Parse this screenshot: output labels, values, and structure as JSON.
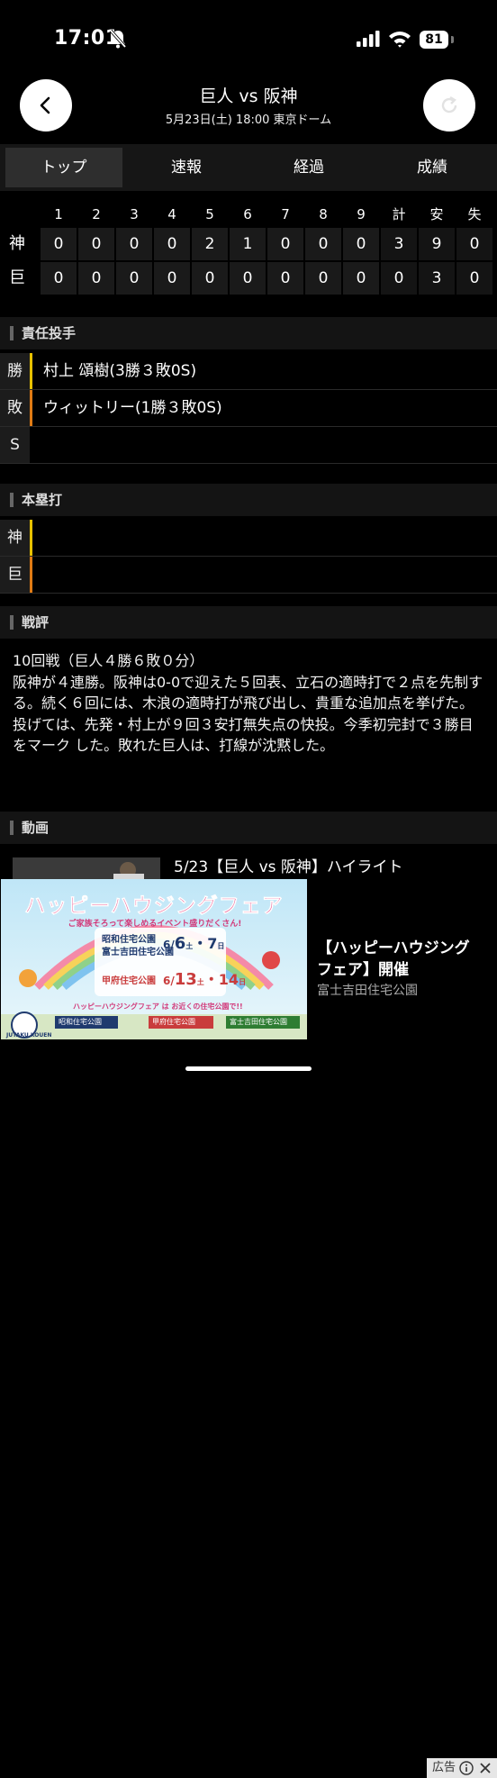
{
  "status": {
    "time": "17:01",
    "battery": "81"
  },
  "header": {
    "title": "巨人 vs 阪神",
    "subtitle": "5月23日(土) 18:00 東京ドーム",
    "back_icon": "chevron-left-icon",
    "refresh_icon": "refresh-icon"
  },
  "tabs": [
    "トップ",
    "速報",
    "経過",
    "成績"
  ],
  "scoreboard": {
    "headers": [
      "1",
      "2",
      "3",
      "4",
      "5",
      "6",
      "7",
      "8",
      "9",
      "計",
      "安",
      "失"
    ],
    "rows": [
      {
        "team": "神",
        "cells": [
          "0",
          "0",
          "0",
          "0",
          "2",
          "1",
          "0",
          "0",
          "0",
          "3",
          "9",
          "0"
        ]
      },
      {
        "team": "巨",
        "cells": [
          "0",
          "0",
          "0",
          "0",
          "0",
          "0",
          "0",
          "0",
          "0",
          "0",
          "3",
          "0"
        ]
      }
    ]
  },
  "pitchers": {
    "heading": "責任投手",
    "rows": [
      {
        "label": "勝",
        "value": "村上 頌樹(3勝３敗0S)",
        "color": "#e8c100"
      },
      {
        "label": "敗",
        "value": "ウィットリー(1勝３敗0S)",
        "color": "#e07b14"
      },
      {
        "label": "S",
        "value": "",
        "color": "#1c1c1c"
      }
    ]
  },
  "homeruns": {
    "heading": "本塁打",
    "rows": [
      {
        "label": "神",
        "value": "",
        "color": "#e8c100"
      },
      {
        "label": "巨",
        "value": "",
        "color": "#e07b14"
      }
    ]
  },
  "review": {
    "heading": "戦評",
    "line1": "10回戦（巨人４勝６敗０分）",
    "body": "阪神が４連勝。阪神は0-0で迎えた５回表、立石の適時打で２点を先制する。続く６回には、木浪の適時打が飛び出し、貴重な追加点を挙げた。投げては、先発・村上が９回３安打無失点の快投。今季初完封で３勝目をマーク した。敗れた巨人は、打線が沈黙した。"
  },
  "video": {
    "heading": "動画",
    "title": "5/23【巨人 vs 阪神】ハイライト"
  },
  "ad": {
    "badge": "広告",
    "title": "【ハッピーハウジング フェア】開催",
    "sponsor": "富士吉田住宅公園",
    "banner_title": "ハッピーハウジングフェア",
    "banner_sub": "ご家族そろって楽しめるイベント盛りだくさん!",
    "venue1": "昭和住宅公園",
    "venue2": "富士吉田住宅公園",
    "venue3": "甲府住宅公園",
    "date1a": "6/",
    "date1b": "6",
    "date1c": "土",
    "date1d": "・7",
    "date1e": "日",
    "date2a": "6/",
    "date2b": "13",
    "date2c": "土",
    "date2d": "・14",
    "date2e": "日",
    "footer": "ハッピーハウジングフェア は お近くの住宅公園で!!",
    "logo": "JUTAKU KOUEN",
    "chip1": "昭和住宅公園",
    "chip2": "甲府住宅公園",
    "chip3": "富士吉田住宅公園"
  }
}
